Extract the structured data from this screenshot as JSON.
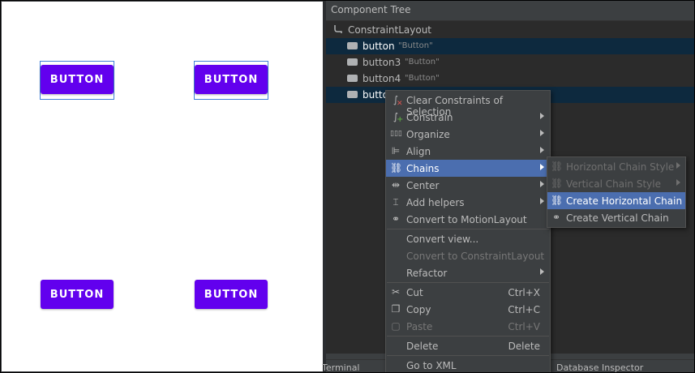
{
  "canvas": {
    "buttons": [
      {
        "label": "BUTTON"
      },
      {
        "label": "BUTTON"
      },
      {
        "label": "BUTTON"
      },
      {
        "label": "BUTTON"
      }
    ]
  },
  "tree": {
    "title": "Component Tree",
    "root": "ConstraintLayout",
    "items": [
      {
        "name": "button",
        "text": "\"Button\""
      },
      {
        "name": "button3",
        "text": "\"Button\""
      },
      {
        "name": "button4",
        "text": "\"Button\""
      },
      {
        "name": "butto",
        "text": ""
      }
    ]
  },
  "bottom_bar": {
    "terminal": "Terminal",
    "database_inspector": "Database Inspector"
  },
  "context_menu": {
    "items": [
      {
        "label": "Clear Constraints of Selection",
        "icon": "clear-constraints-icon"
      },
      {
        "label": "Constrain",
        "icon": "constrain-icon"
      },
      {
        "label": "Organize",
        "icon": "organize-icon"
      },
      {
        "label": "Align",
        "icon": "align-icon"
      },
      {
        "label": "Chains",
        "icon": "chains-icon"
      },
      {
        "label": "Center",
        "icon": "center-icon"
      },
      {
        "label": "Add helpers",
        "icon": "add-helpers-icon"
      },
      {
        "label": "Convert to MotionLayout",
        "icon": "motion-layout-icon"
      },
      {
        "label": "Convert view..."
      },
      {
        "label": "Convert to ConstraintLayout"
      },
      {
        "label": "Refactor"
      },
      {
        "label": "Cut",
        "shortcut": "Ctrl+X",
        "icon": "scissors-icon"
      },
      {
        "label": "Copy",
        "shortcut": "Ctrl+C",
        "icon": "copy-icon"
      },
      {
        "label": "Paste",
        "shortcut": "Ctrl+V",
        "icon": "paste-icon"
      },
      {
        "label": "Delete",
        "shortcut": "Delete"
      },
      {
        "label": "Go to XML"
      }
    ]
  },
  "chains_submenu": {
    "items": [
      {
        "label": "Horizontal Chain Style"
      },
      {
        "label": "Vertical Chain Style"
      },
      {
        "label": "Create Horizontal Chain"
      },
      {
        "label": "Create Vertical Chain"
      }
    ]
  },
  "colors": {
    "button": "#6200ee",
    "menu_active": "#4b6eaf",
    "tree_selection": "#0d293e"
  }
}
